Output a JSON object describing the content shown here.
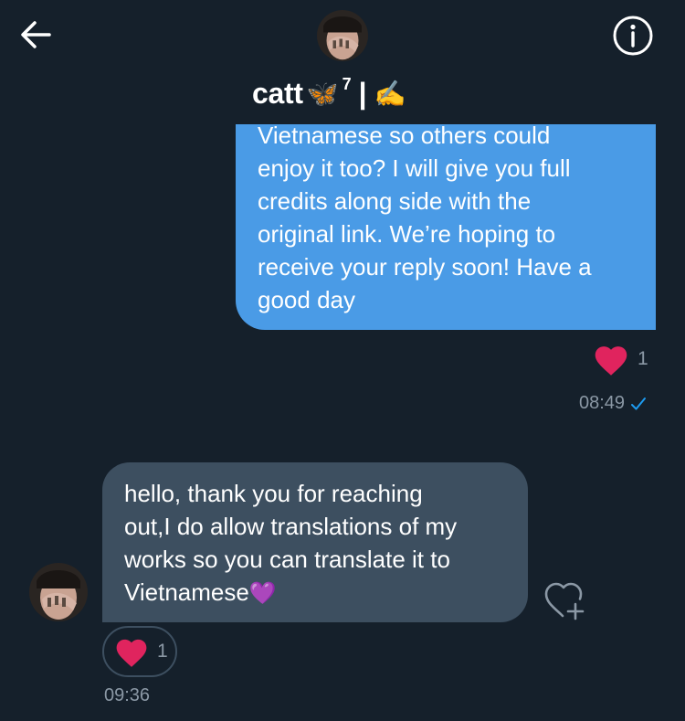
{
  "header": {
    "back_icon": "back-arrow-icon",
    "info_icon": "info-icon",
    "contact": {
      "name": "catt",
      "emoji_butterfly": "🦋",
      "superscript": "7",
      "separator": "|",
      "emoji_writing": "✍️"
    }
  },
  "messages": [
    {
      "direction": "outgoing",
      "text": "Vietnamese so others could\nenjoy it too? I will give you full\ncredits along side with the\noriginal link. We’re hoping to\nreceive your reply soon! Have a\ngood day",
      "reaction": {
        "icon": "heart-icon",
        "count": "1"
      },
      "time": "08:49",
      "status_icon": "checkmark-icon"
    },
    {
      "direction": "incoming",
      "text": "hello, thank you for reaching\nout,I do allow translations of my\nworks so you can translate it to\nVietnamese",
      "trailing_emoji": "💜",
      "reaction": {
        "icon": "heart-icon",
        "count": "1"
      },
      "add_reaction_icon": "heart-plus-icon",
      "time": "09:36"
    }
  ],
  "colors": {
    "background": "#15202b",
    "outgoing_bubble": "#4a9be6",
    "incoming_bubble": "#3d4f60",
    "heart": "#e0245e",
    "muted_text": "#8b98a5",
    "accent": "#1d9bf0"
  }
}
